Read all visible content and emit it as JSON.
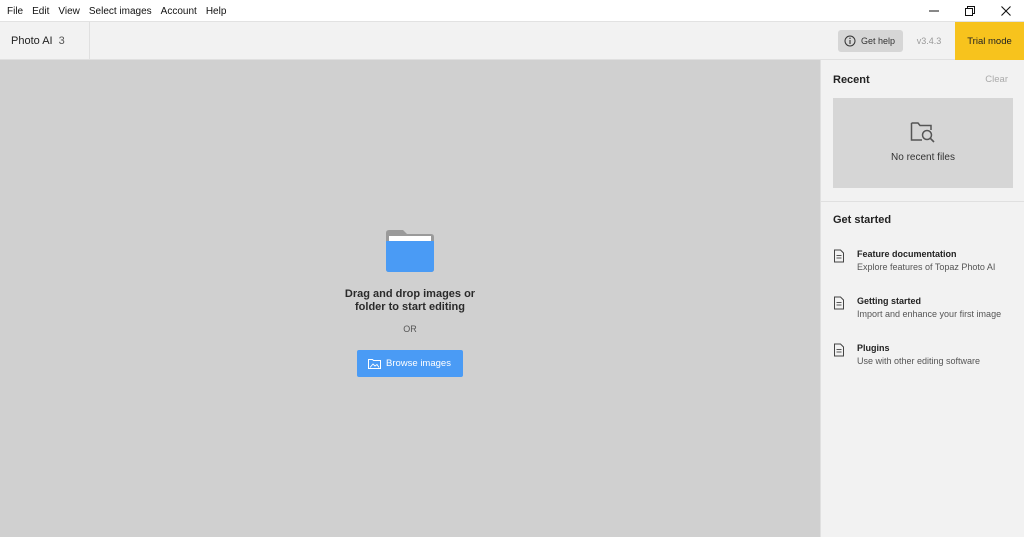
{
  "menu": [
    "File",
    "Edit",
    "View",
    "Select images",
    "Account",
    "Help"
  ],
  "header": {
    "app_name": "Photo AI",
    "count": "3",
    "help_label": "Get help",
    "version": "v3.4.3",
    "trial_label": "Trial mode"
  },
  "drop": {
    "line1": "Drag and drop images or",
    "line2": "folder to start editing",
    "or": "OR",
    "browse_label": "Browse images"
  },
  "recent": {
    "title": "Recent",
    "clear_label": "Clear",
    "empty_text": "No recent files"
  },
  "get_started": {
    "title": "Get started",
    "items": [
      {
        "name": "Feature documentation",
        "desc": "Explore features of Topaz Photo AI"
      },
      {
        "name": "Getting started",
        "desc": "Import and enhance your first image"
      },
      {
        "name": "Plugins",
        "desc": "Use with other editing software"
      }
    ]
  },
  "colors": {
    "accent": "#4a9bf5",
    "trial": "#f7c31d",
    "drop_bg": "#d0d0d0",
    "panel_bg": "#f2f2f2"
  },
  "icons": [
    "minimize-icon",
    "restore-icon",
    "close-icon",
    "info-icon",
    "folder-icon",
    "image-folder-icon",
    "folder-search-icon",
    "document-icon"
  ]
}
